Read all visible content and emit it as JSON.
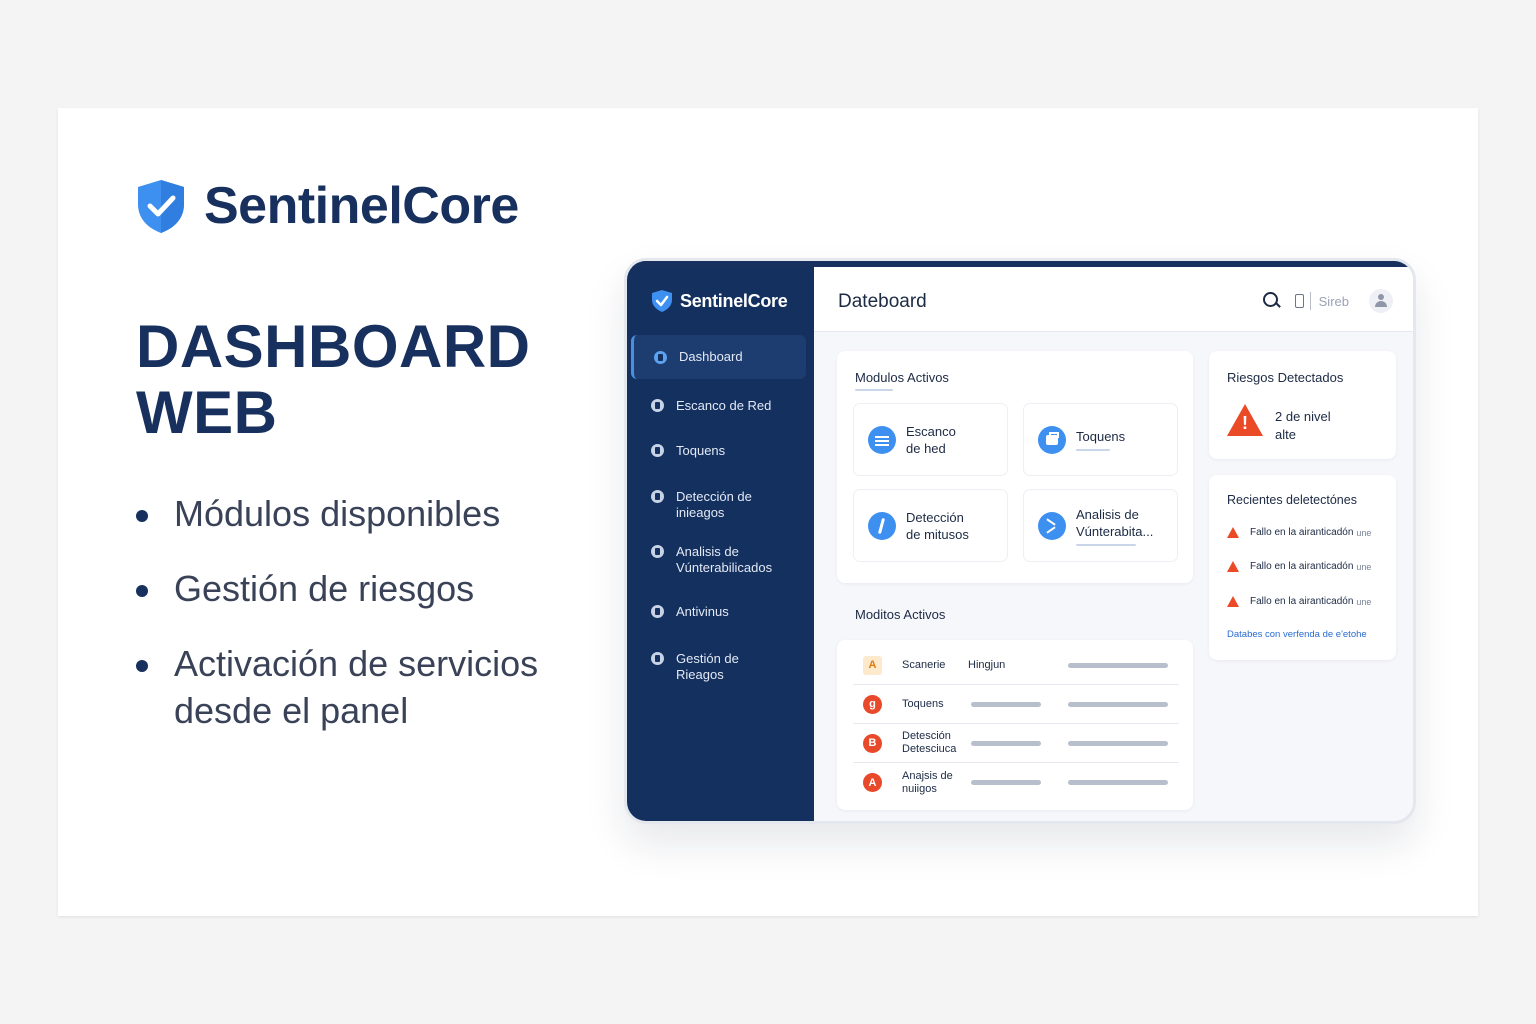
{
  "brand": {
    "name": "SentinelCore",
    "accent": "#17305e",
    "shield_color": "#3d8ff0"
  },
  "hero": {
    "title_line1": "DASHBOARD",
    "title_line2": "WEB"
  },
  "bullets": [
    "Módulos disponibles",
    "Gestión de riesgos",
    "Activación de servicios desde el panel"
  ],
  "app": {
    "sidebar": {
      "brand": "SentinelCore",
      "items": [
        {
          "label": "Dashboard",
          "active": true
        },
        {
          "label": "Escanco de Red"
        },
        {
          "label": "Toquens"
        },
        {
          "label": "Detección de\ninieagos"
        },
        {
          "label": "Analisis de\nVúnterabilicados"
        },
        {
          "label": "Antivinus"
        },
        {
          "label": "Gestión de\nRieagos"
        }
      ]
    },
    "header": {
      "title": "Dateboard",
      "label": "Sireb",
      "icons": [
        "search-icon",
        "phone-icon",
        "avatar-icon"
      ]
    },
    "modules": {
      "title": "Modulos Activos",
      "cards": [
        {
          "label": "Escanco\nde hed",
          "icon": "lines-icon"
        },
        {
          "label": "Toquens",
          "icon": "briefcase-icon"
        },
        {
          "label": "Detección\nde mitusos",
          "icon": "bolt-icon"
        },
        {
          "label": "Analisis de\nVúnterabita...",
          "icon": "arrow-icon"
        }
      ]
    },
    "rows": {
      "title": "Moditos Activos",
      "items": [
        {
          "icon": "A",
          "name": "Scanerie",
          "value": "Hingjun",
          "square": true
        },
        {
          "icon": "g",
          "name": "Toquens",
          "value": ""
        },
        {
          "icon": "B",
          "name": "Detesción\nDetesciuca",
          "value": ""
        },
        {
          "icon": "A",
          "name": "Anajsis de\nnuiigos",
          "value": ""
        }
      ]
    },
    "risks": {
      "title": "Riesgos Detectados",
      "text": "2 de nivel\nalte",
      "color": "#ea4a26"
    },
    "recent": {
      "title": "Recientes deletectónes",
      "items": [
        {
          "text": "Fallo en la airanticadón",
          "suffix": "une"
        },
        {
          "text": "Fallo en la airanticadón",
          "suffix": "une"
        },
        {
          "text": "Fallo en la airanticadón",
          "suffix": "une"
        }
      ],
      "link": "Databes con verfenda de e'etohe"
    }
  }
}
